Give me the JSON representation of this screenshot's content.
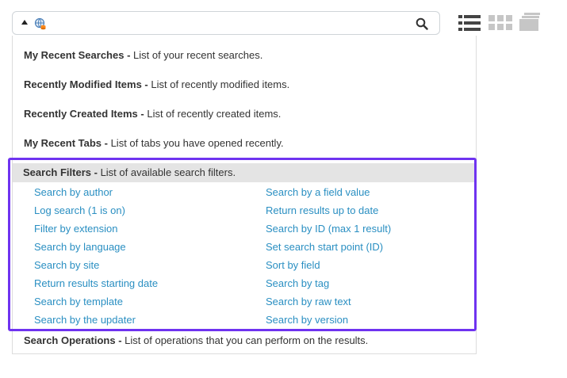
{
  "search": {
    "value": ""
  },
  "sections": {
    "recent_searches": {
      "title": "My Recent Searches",
      "desc": "List of your recent searches."
    },
    "recently_modified": {
      "title": "Recently Modified Items",
      "desc": "List of recently modified items."
    },
    "recently_created": {
      "title": "Recently Created Items",
      "desc": "List of recently created items."
    },
    "recent_tabs": {
      "title": "My Recent Tabs",
      "desc": "List of tabs you have opened recently."
    },
    "search_filters": {
      "title": "Search Filters",
      "desc": "List of available search filters."
    },
    "search_operations": {
      "title": "Search Operations",
      "desc": "List of operations that you can perform on the results."
    }
  },
  "filters_left": [
    "Search by author",
    "Log search (1 is on)",
    "Filter by extension",
    "Search by language",
    "Search by site",
    "Return results starting date",
    "Search by template",
    "Search by the updater"
  ],
  "filters_right": [
    "Search by a field value",
    "Return results up to date",
    "Search by ID (max 1 result)",
    "Set search start point (ID)",
    "Sort by field",
    "Search by tag",
    "Search by raw text",
    "Search by version"
  ],
  "colors": {
    "highlight": "#6f33f0",
    "link": "#2a8fc2"
  }
}
